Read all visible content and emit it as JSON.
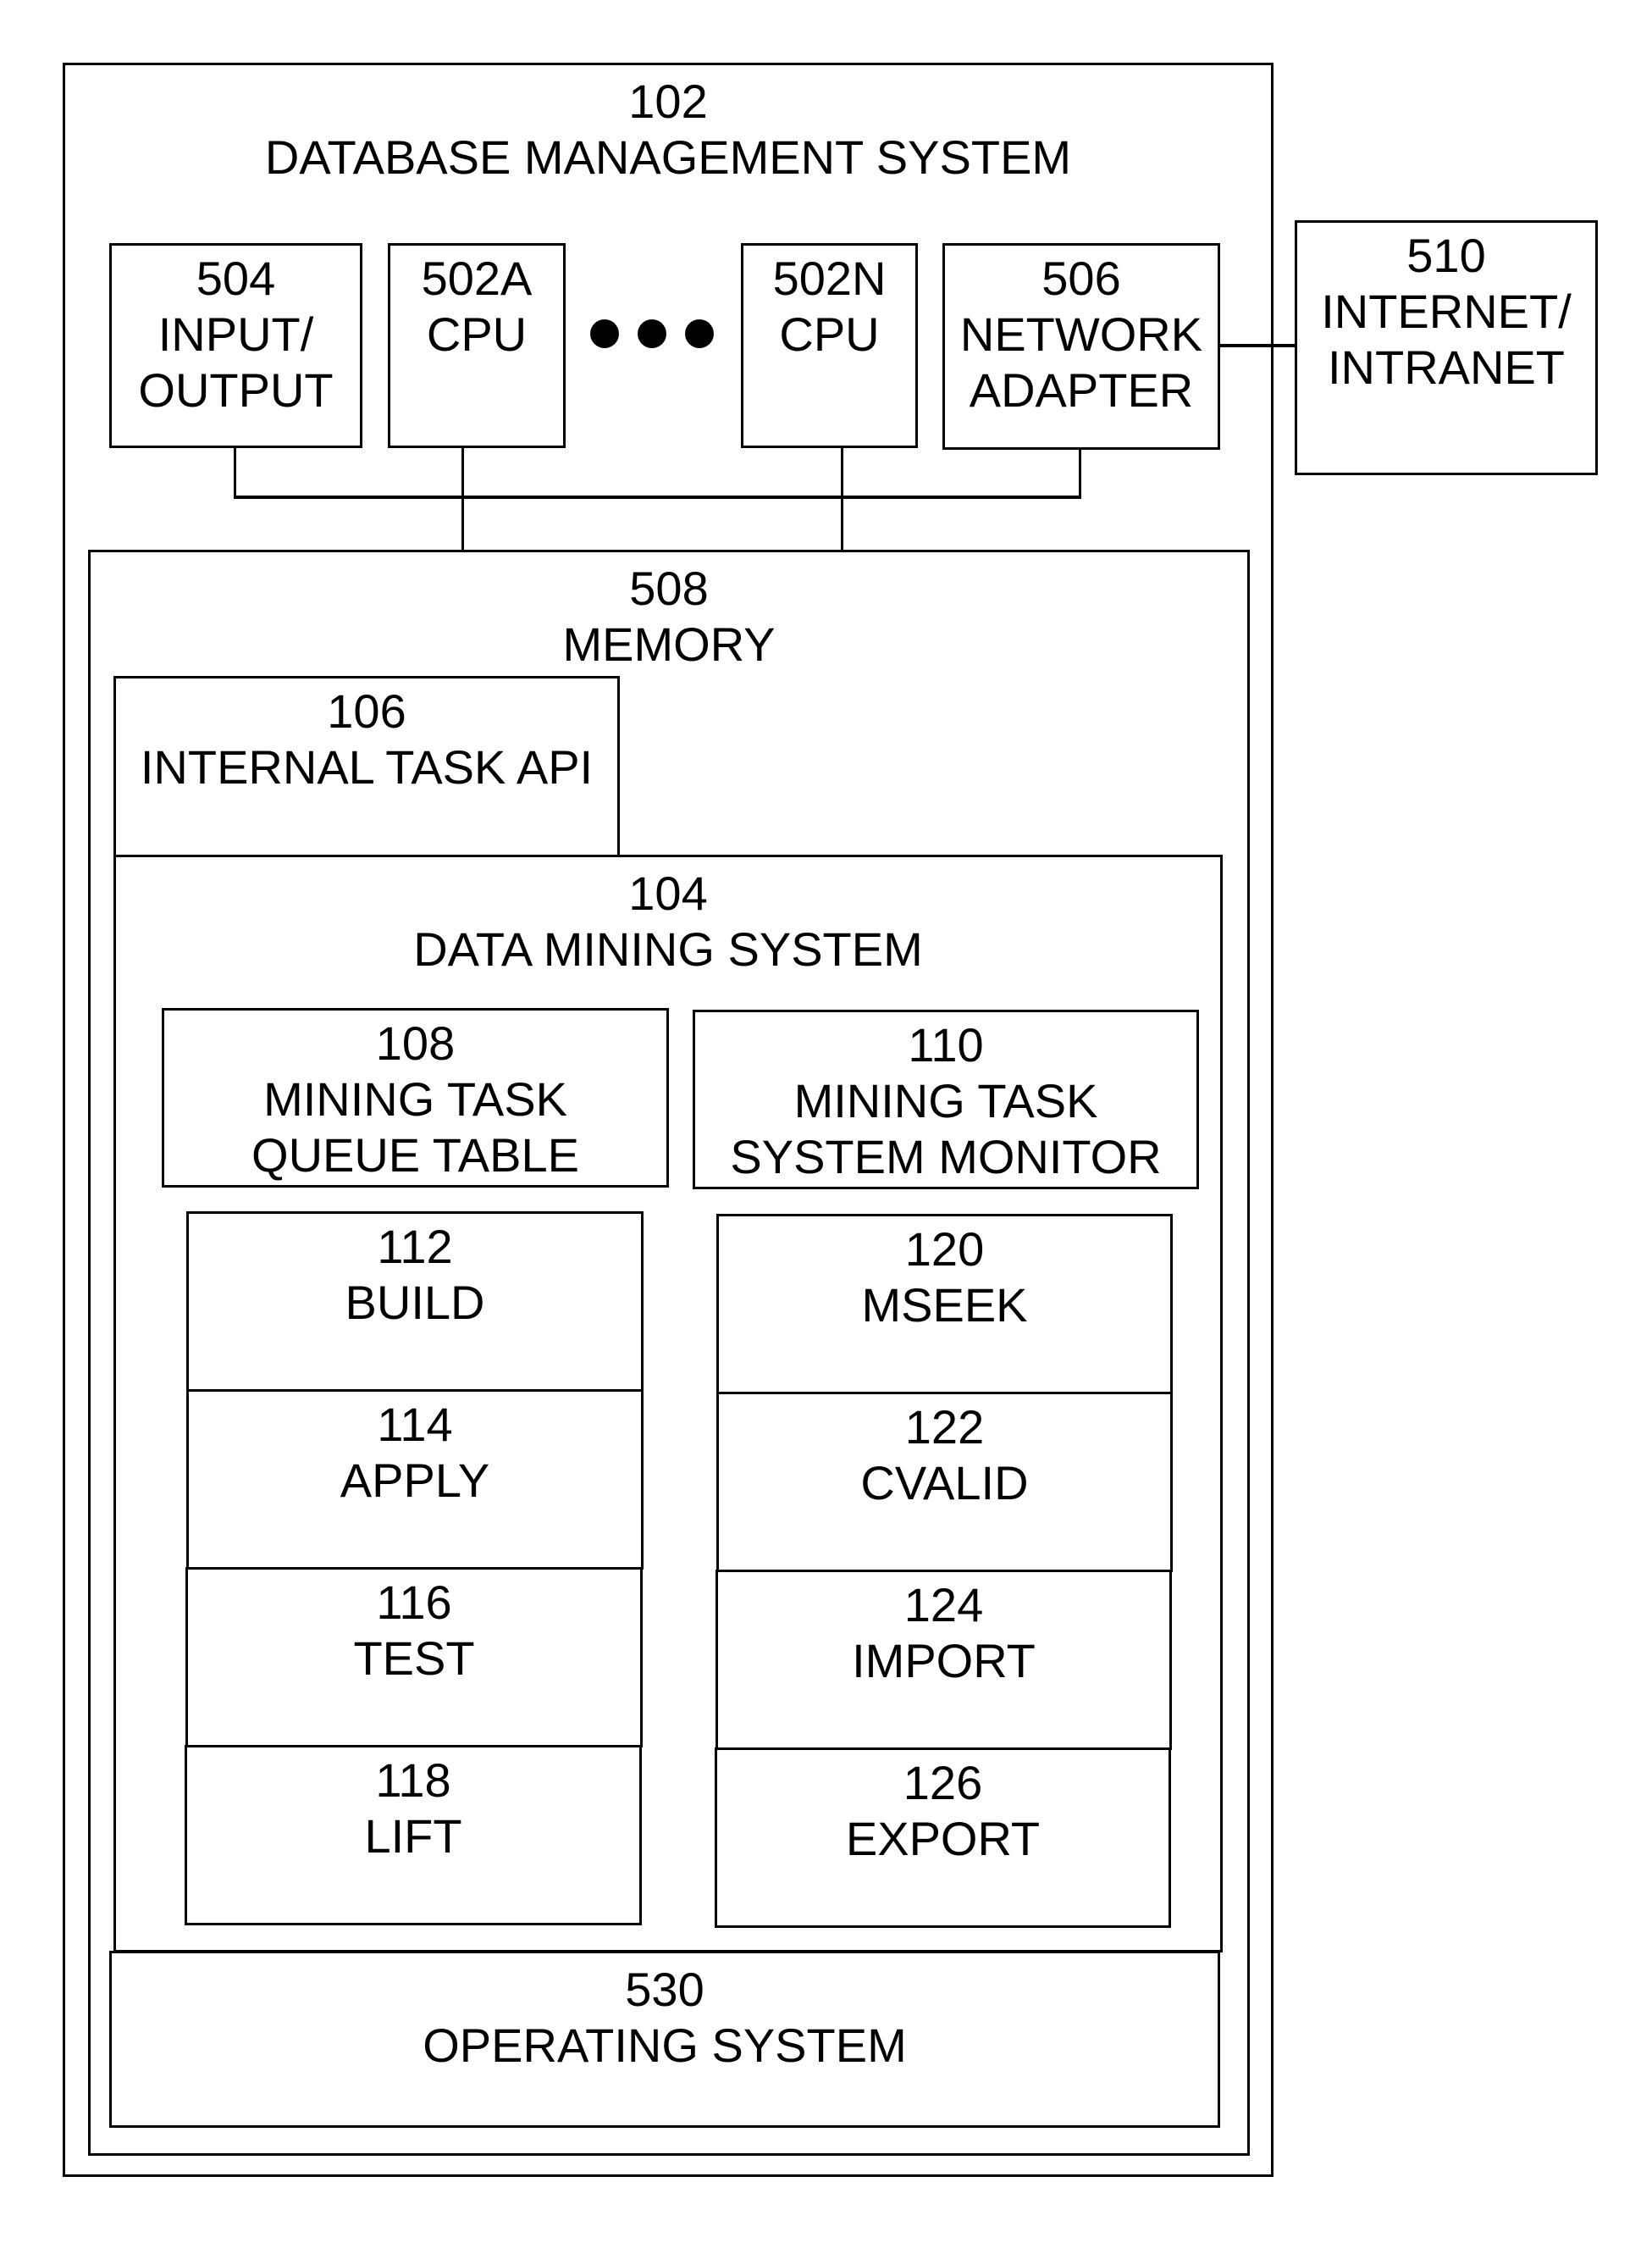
{
  "diagram": {
    "dbms": {
      "id": "102",
      "label": "DATABASE MANAGEMENT SYSTEM"
    },
    "io": {
      "id": "504",
      "label_lines": [
        "INPUT/",
        "OUTPUT"
      ]
    },
    "cpu_a": {
      "id": "502A",
      "label": "CPU"
    },
    "cpu_n": {
      "id": "502N",
      "label": "CPU"
    },
    "ellipsis": "dots-icon",
    "network_adapter": {
      "id": "506",
      "label_lines": [
        "NETWORK",
        "ADAPTER"
      ]
    },
    "internet": {
      "id": "510",
      "label_lines": [
        "INTERNET/",
        "INTRANET"
      ]
    },
    "memory": {
      "id": "508",
      "label": "MEMORY"
    },
    "internal_task_api": {
      "id": "106",
      "label": "INTERNAL TASK API"
    },
    "data_mining_system": {
      "id": "104",
      "label": "DATA MINING SYSTEM"
    },
    "queue_table": {
      "id": "108",
      "label_lines": [
        "MINING TASK",
        "QUEUE TABLE"
      ]
    },
    "system_monitor": {
      "id": "110",
      "label_lines": [
        "MINING TASK",
        "SYSTEM MONITOR"
      ]
    },
    "left_tasks": [
      {
        "id": "112",
        "label": "BUILD"
      },
      {
        "id": "114",
        "label": "APPLY"
      },
      {
        "id": "116",
        "label": "TEST"
      },
      {
        "id": "118",
        "label": "LIFT"
      }
    ],
    "right_tasks": [
      {
        "id": "120",
        "label": "MSEEK"
      },
      {
        "id": "122",
        "label": "CVALID"
      },
      {
        "id": "124",
        "label": "IMPORT"
      },
      {
        "id": "126",
        "label": "EXPORT"
      }
    ],
    "operating_system": {
      "id": "530",
      "label": "OPERATING SYSTEM"
    }
  }
}
